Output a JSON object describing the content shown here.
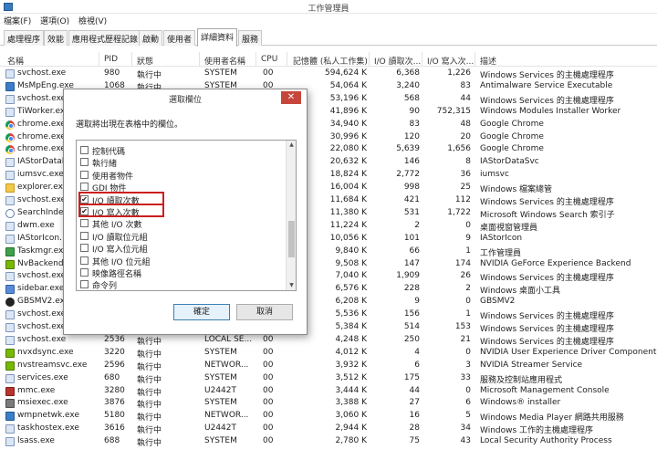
{
  "window": {
    "title": "工作管理員"
  },
  "menu": [
    "檔案(F)",
    "選項(O)",
    "檢視(V)"
  ],
  "tabs": [
    {
      "label": "處理程序",
      "active": false
    },
    {
      "label": "效能",
      "active": false
    },
    {
      "label": "應用程式歷程記錄",
      "active": false
    },
    {
      "label": "啟動",
      "active": false
    },
    {
      "label": "使用者",
      "active": false
    },
    {
      "label": "詳細資料",
      "active": true
    },
    {
      "label": "服務",
      "active": false
    }
  ],
  "columns": [
    "名稱",
    "PID",
    "狀態",
    "使用者名稱",
    "CPU",
    "記憶體 (私人工作集)",
    "I/O 讀取次...",
    "I/O 寫入次...",
    "描述"
  ],
  "rows": [
    {
      "icon": "generic-process-icon",
      "name": "svchost.exe",
      "pid": "980",
      "status": "執行中",
      "user": "SYSTEM",
      "cpu": "00",
      "mem": "594,624 K",
      "ioread": "6,368",
      "iowrite": "1,226",
      "desc": "Windows Services 的主機處理程序"
    },
    {
      "icon": "defender-icon",
      "name": "MsMpEng.exe",
      "pid": "1068",
      "status": "執行中",
      "user": "SYSTEM",
      "cpu": "00",
      "mem": "54,064 K",
      "ioread": "3,240",
      "iowrite": "83",
      "desc": "Antimalware Service Executable"
    },
    {
      "icon": "generic-process-icon",
      "name": "svchost.exe",
      "pid": "",
      "status": "",
      "user": "",
      "cpu": "",
      "mem": "53,196 K",
      "ioread": "568",
      "iowrite": "44",
      "desc": "Windows Services 的主機處理程序"
    },
    {
      "icon": "generic-process-icon",
      "name": "TiWorker.ex",
      "pid": "",
      "status": "",
      "user": "",
      "cpu": "",
      "mem": "41,896 K",
      "ioread": "90",
      "iowrite": "752,315",
      "desc": "Windows Modules Installer Worker"
    },
    {
      "icon": "chrome-icon",
      "name": "chrome.exe",
      "pid": "",
      "status": "",
      "user": "",
      "cpu": "",
      "mem": "34,940 K",
      "ioread": "83",
      "iowrite": "48",
      "desc": "Google Chrome"
    },
    {
      "icon": "chrome-icon",
      "name": "chrome.exe",
      "pid": "",
      "status": "",
      "user": "",
      "cpu": "",
      "mem": "30,996 K",
      "ioread": "120",
      "iowrite": "20",
      "desc": "Google Chrome"
    },
    {
      "icon": "chrome-icon",
      "name": "chrome.exe",
      "pid": "",
      "status": "",
      "user": "",
      "cpu": "",
      "mem": "22,080 K",
      "ioread": "5,639",
      "iowrite": "1,656",
      "desc": "Google Chrome"
    },
    {
      "icon": "generic-process-icon",
      "name": "IAStorDataI",
      "pid": "",
      "status": "",
      "user": "",
      "cpu": "",
      "mem": "20,632 K",
      "ioread": "146",
      "iowrite": "8",
      "desc": "IAStorDataSvc"
    },
    {
      "icon": "generic-process-icon",
      "name": "iumsvc.exe",
      "pid": "",
      "status": "",
      "user": "",
      "cpu": "",
      "mem": "18,824 K",
      "ioread": "2,772",
      "iowrite": "36",
      "desc": "iumsvc"
    },
    {
      "icon": "folder-icon",
      "name": "explorer.ex",
      "pid": "",
      "status": "",
      "user": "",
      "cpu": "",
      "mem": "16,004 K",
      "ioread": "998",
      "iowrite": "25",
      "desc": "Windows 檔案總管"
    },
    {
      "icon": "generic-process-icon",
      "name": "svchost.exe",
      "pid": "",
      "status": "",
      "user": "",
      "cpu": "",
      "mem": "11,684 K",
      "ioread": "421",
      "iowrite": "112",
      "desc": "Windows Services 的主機處理程序"
    },
    {
      "icon": "search-icon",
      "name": "SearchIndex",
      "pid": "",
      "status": "",
      "user": "",
      "cpu": "",
      "mem": "11,380 K",
      "ioread": "531",
      "iowrite": "1,722",
      "desc": "Microsoft Windows Search 索引子"
    },
    {
      "icon": "generic-process-icon",
      "name": "dwm.exe",
      "pid": "",
      "status": "",
      "user": "",
      "cpu": "",
      "mem": "11,224 K",
      "ioread": "2",
      "iowrite": "0",
      "desc": "桌面視窗管理員"
    },
    {
      "icon": "generic-process-icon",
      "name": "IAStorIcon.",
      "pid": "",
      "status": "",
      "user": "",
      "cpu": "",
      "mem": "10,056 K",
      "ioread": "101",
      "iowrite": "9",
      "desc": "IAStorIcon"
    },
    {
      "icon": "taskmgr-icon",
      "name": "Taskmgr.ex",
      "pid": "",
      "status": "",
      "user": "",
      "cpu": "",
      "mem": "9,840 K",
      "ioread": "66",
      "iowrite": "1",
      "desc": "工作管理員"
    },
    {
      "icon": "nvidia-icon",
      "name": "NvBackend",
      "pid": "",
      "status": "",
      "user": "",
      "cpu": "",
      "mem": "9,508 K",
      "ioread": "147",
      "iowrite": "174",
      "desc": "NVIDIA GeForce Experience Backend"
    },
    {
      "icon": "generic-process-icon",
      "name": "svchost.exe",
      "pid": "",
      "status": "",
      "user": "",
      "cpu": "",
      "mem": "7,040 K",
      "ioread": "1,909",
      "iowrite": "26",
      "desc": "Windows Services 的主機處理程序"
    },
    {
      "icon": "sidebar-icon",
      "name": "sidebar.exe",
      "pid": "",
      "status": "",
      "user": "",
      "cpu": "",
      "mem": "6,576 K",
      "ioread": "228",
      "iowrite": "2",
      "desc": "Windows 桌面小工具"
    },
    {
      "icon": "gbs-icon",
      "name": "GBSMV2.ex",
      "pid": "",
      "status": "",
      "user": "",
      "cpu": "",
      "mem": "6,208 K",
      "ioread": "9",
      "iowrite": "0",
      "desc": "GBSMV2"
    },
    {
      "icon": "generic-process-icon",
      "name": "svchost.exe",
      "pid": "",
      "status": "",
      "user": "",
      "cpu": "",
      "mem": "5,536 K",
      "ioread": "156",
      "iowrite": "1",
      "desc": "Windows Services 的主機處理程序"
    },
    {
      "icon": "generic-process-icon",
      "name": "svchost.exe",
      "pid": "",
      "status": "",
      "user": "",
      "cpu": "",
      "mem": "5,384 K",
      "ioread": "514",
      "iowrite": "153",
      "desc": "Windows Services 的主機處理程序"
    },
    {
      "icon": "generic-process-icon",
      "name": "svchost.exe",
      "pid": "2536",
      "status": "執行中",
      "user": "LOCAL SE...",
      "cpu": "00",
      "mem": "4,248 K",
      "ioread": "250",
      "iowrite": "21",
      "desc": "Windows Services 的主機處理程序"
    },
    {
      "icon": "nvidia-icon",
      "name": "nvxdsync.exe",
      "pid": "3220",
      "status": "執行中",
      "user": "SYSTEM",
      "cpu": "00",
      "mem": "4,012 K",
      "ioread": "4",
      "iowrite": "0",
      "desc": "NVIDIA User Experience Driver Component"
    },
    {
      "icon": "nvidia-icon",
      "name": "nvstreamsvc.exe",
      "pid": "2596",
      "status": "執行中",
      "user": "NETWOR...",
      "cpu": "00",
      "mem": "3,932 K",
      "ioread": "6",
      "iowrite": "3",
      "desc": "NVIDIA Streamer Service"
    },
    {
      "icon": "generic-process-icon",
      "name": "services.exe",
      "pid": "680",
      "status": "執行中",
      "user": "SYSTEM",
      "cpu": "00",
      "mem": "3,512 K",
      "ioread": "175",
      "iowrite": "33",
      "desc": "服務及控制站應用程式"
    },
    {
      "icon": "mmc-icon",
      "name": "mmc.exe",
      "pid": "3280",
      "status": "執行中",
      "user": "U2442T",
      "cpu": "00",
      "mem": "3,444 K",
      "ioread": "44",
      "iowrite": "0",
      "desc": "Microsoft Management Console"
    },
    {
      "icon": "msiexec-icon",
      "name": "msiexec.exe",
      "pid": "3876",
      "status": "執行中",
      "user": "SYSTEM",
      "cpu": "00",
      "mem": "3,388 K",
      "ioread": "27",
      "iowrite": "6",
      "desc": "Windows® installer"
    },
    {
      "icon": "wmp-icon",
      "name": "wmpnetwk.exe",
      "pid": "5180",
      "status": "執行中",
      "user": "NETWOR...",
      "cpu": "00",
      "mem": "3,060 K",
      "ioread": "16",
      "iowrite": "5",
      "desc": "Windows Media Player 網路共用服務"
    },
    {
      "icon": "generic-process-icon",
      "name": "taskhostex.exe",
      "pid": "3616",
      "status": "執行中",
      "user": "U2442T",
      "cpu": "00",
      "mem": "2,944 K",
      "ioread": "28",
      "iowrite": "34",
      "desc": "Windows 工作的主機處理程序"
    },
    {
      "icon": "generic-process-icon",
      "name": "lsass.exe",
      "pid": "688",
      "status": "執行中",
      "user": "SYSTEM",
      "cpu": "00",
      "mem": "2,780 K",
      "ioread": "75",
      "iowrite": "43",
      "desc": "Local Security Authority Process"
    }
  ],
  "dialog": {
    "title": "選取欄位",
    "close": "✕",
    "instruction": "選取將出現在表格中的欄位。",
    "items": [
      {
        "label": "控制代碼",
        "checked": false
      },
      {
        "label": "執行緒",
        "checked": false
      },
      {
        "label": "使用者物件",
        "checked": false
      },
      {
        "label": "GDI 物件",
        "checked": false
      },
      {
        "label": "I/O 讀取次數",
        "checked": true
      },
      {
        "label": "I/O 寫入次數",
        "checked": true
      },
      {
        "label": "其他 I/O 次數",
        "checked": false
      },
      {
        "label": "I/O 讀取位元組",
        "checked": false
      },
      {
        "label": "I/O 寫入位元組",
        "checked": false
      },
      {
        "label": "其他 I/O 位元組",
        "checked": false
      },
      {
        "label": "映像路徑名稱",
        "checked": false
      },
      {
        "label": "命令列",
        "checked": false
      }
    ],
    "ok": "確定",
    "cancel": "取消"
  }
}
